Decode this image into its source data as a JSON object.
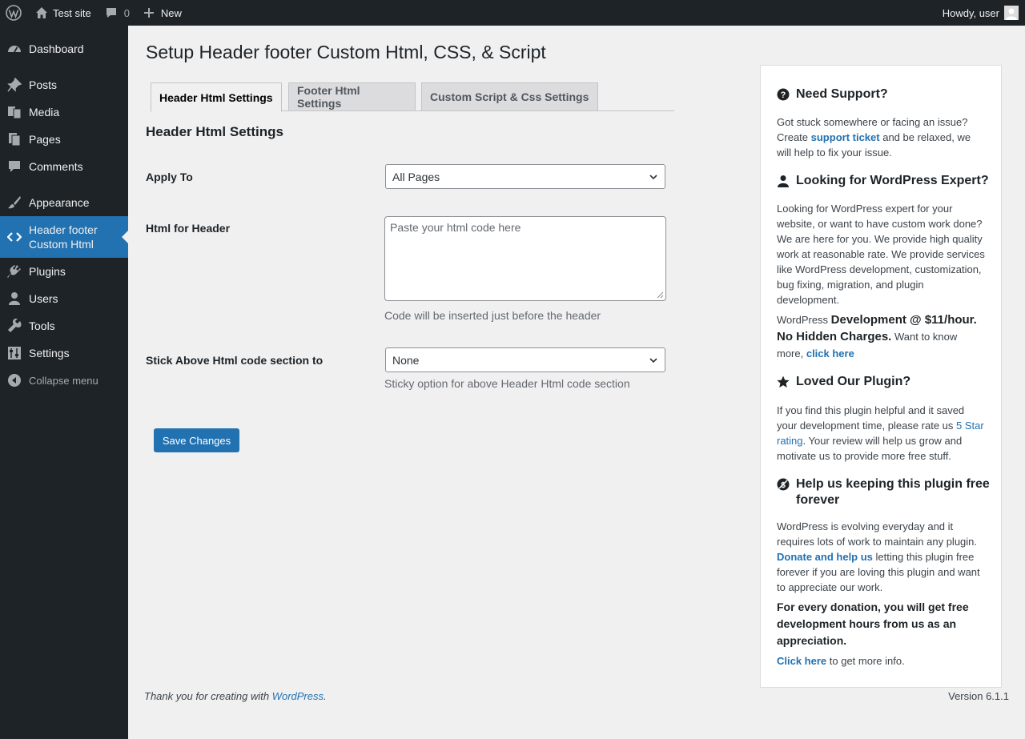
{
  "admin_bar": {
    "site_name": "Test site",
    "comments_count": "0",
    "new_label": "New",
    "howdy": "Howdy, user"
  },
  "sidebar": {
    "items": [
      {
        "label": "Dashboard",
        "icon": "dashboard-icon"
      },
      {
        "label": "Posts",
        "icon": "pin-icon"
      },
      {
        "label": "Media",
        "icon": "media-icon"
      },
      {
        "label": "Pages",
        "icon": "pages-icon"
      },
      {
        "label": "Comments",
        "icon": "comment-icon"
      },
      {
        "label": "Appearance",
        "icon": "brush-icon"
      },
      {
        "label": "Header footer Custom Html",
        "icon": "code-icon"
      },
      {
        "label": "Plugins",
        "icon": "plug-icon"
      },
      {
        "label": "Users",
        "icon": "user-icon"
      },
      {
        "label": "Tools",
        "icon": "wrench-icon"
      },
      {
        "label": "Settings",
        "icon": "settings-icon"
      }
    ],
    "collapse_label": "Collapse menu"
  },
  "main": {
    "page_title": "Setup Header footer Custom Html, CSS, & Script",
    "tabs": [
      {
        "label": "Header Html Settings",
        "active": true
      },
      {
        "label": "Footer Html Settings",
        "active": false
      },
      {
        "label": "Custom Script & Css Settings",
        "active": false
      }
    ],
    "section_title": "Header Html Settings",
    "apply_to": {
      "label": "Apply To",
      "value": "All Pages"
    },
    "html_for_header": {
      "label": "Html for Header",
      "placeholder": "Paste your html code here",
      "description": "Code will be inserted just before the header"
    },
    "stick": {
      "label": "Stick Above Html code section to",
      "value": "None",
      "description": "Sticky option for above Header Html code section"
    },
    "save_label": "Save Changes"
  },
  "support": {
    "need_support": {
      "title": "Need Support?",
      "text_before": "Got stuck somewhere or facing an issue? Create ",
      "link": "support ticket",
      "text_after": " and be relaxed, we will help to fix your issue."
    },
    "expert": {
      "title": "Looking for WordPress Expert?",
      "text": "Looking for WordPress expert for your website, or want to have custom work done? We are here for you. We provide high quality work at reasonable rate. We provide services like WordPress development, customization, bug fixing, migration, and plugin development.",
      "prefix": "WordPress ",
      "highlight": "Development @ $11/hour. No Hidden Charges.",
      "suffix": " Want to know more, ",
      "link": "click here"
    },
    "loved": {
      "title": "Loved Our Plugin?",
      "text_before": "If you find this plugin helpful and it saved your development time, please rate us ",
      "link": "5 Star rating",
      "text_after": ". Your review will help us grow and motivate us to provide more free stuff."
    },
    "free": {
      "title": "Help us keeping this plugin free forever",
      "text_before": "WordPress is evolving everyday and it requires lots of work to maintain any plugin. ",
      "link": "Donate and help us",
      "text_after": " letting this plugin free forever if you are loving this plugin and want to appreciate our work.",
      "bold": "For every donation, you will get free development hours from us as an appreciation.",
      "click_link": "Click here",
      "click_after": " to get more info."
    }
  },
  "footer": {
    "thanks_before": "Thank you for creating with ",
    "thanks_link": "WordPress",
    "thanks_after": ".",
    "version": "Version 6.1.1"
  },
  "colors": {
    "admin_bar": "#1d2327",
    "sidebar": "#1d2327",
    "accent": "#2271b1",
    "background": "#f0f0f1"
  }
}
